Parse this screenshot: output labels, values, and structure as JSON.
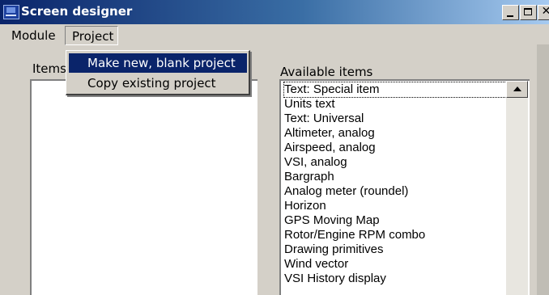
{
  "window": {
    "title": "Screen designer"
  },
  "menu": {
    "module": "Module",
    "project": "Project"
  },
  "dropdown": {
    "items": [
      "Make new, blank project",
      "Copy existing project"
    ]
  },
  "left_panel": {
    "label": "Items i"
  },
  "available": {
    "label": "Available items",
    "items": [
      "Text: Special item",
      "Units text",
      "Text: Universal",
      "Altimeter, analog",
      "Airspeed, analog",
      "VSI, analog",
      "Bargraph",
      "Analog meter (roundel)",
      "Horizon",
      "GPS Moving Map",
      "Rotor/Engine RPM combo",
      "Drawing primitives",
      "Wind vector",
      "VSI History display"
    ]
  },
  "colors": {
    "titlebar_start": "#0a246a",
    "titlebar_end": "#a6caf0",
    "highlight": "#0a246a",
    "face": "#d4d0c8"
  },
  "icons": {
    "app": "screen-designer-app-icon",
    "minimize": "minimize-icon",
    "maximize": "maximize-icon",
    "close": "close-icon",
    "scroll_up": "scroll-up-arrow-icon"
  }
}
